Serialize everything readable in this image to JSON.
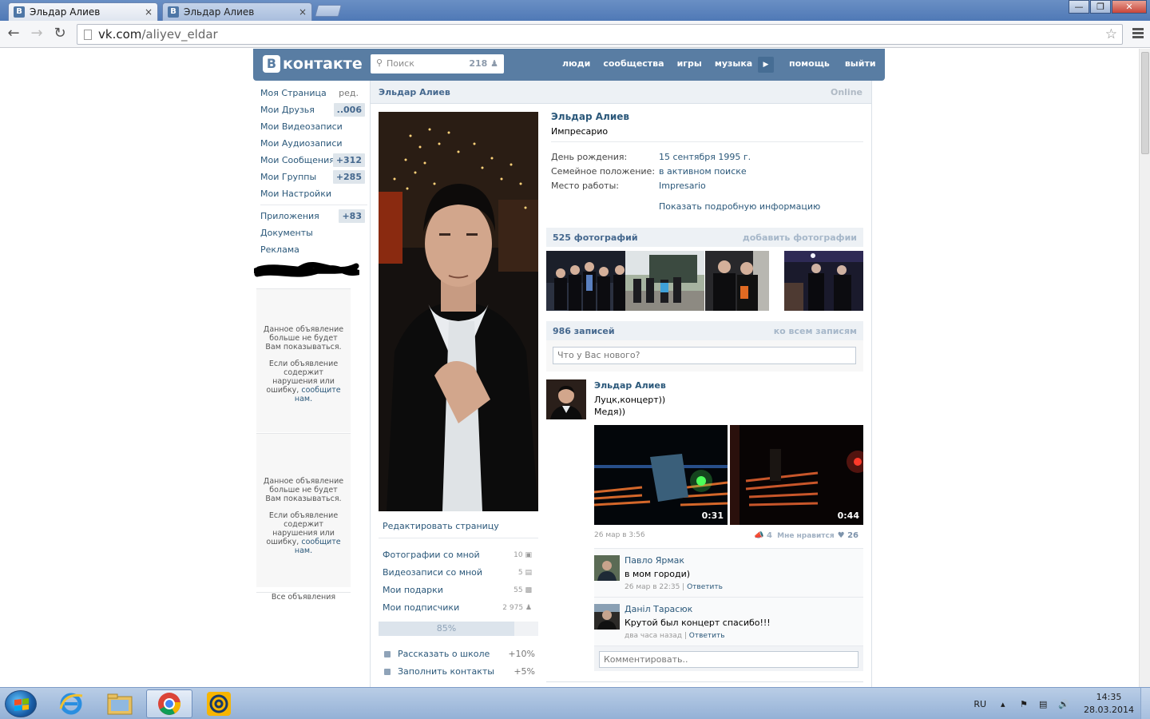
{
  "browser": {
    "tabs": [
      {
        "title": "Эльдар Алиев",
        "active": true
      },
      {
        "title": "Эльдар Алиев",
        "active": false
      }
    ],
    "tab_close": "×",
    "url_host": "vk.com",
    "url_path": "/aliyev_eldar",
    "window_buttons": {
      "minimize": "—",
      "maximize": "❐",
      "close": "✕"
    }
  },
  "vk": {
    "logo_letter": "В",
    "logo_text": "контакте",
    "search": {
      "placeholder": "Поиск",
      "count": "218"
    },
    "nav": [
      "люди",
      "сообщества",
      "игры",
      "музыка"
    ],
    "nav_right": [
      "помощь",
      "выйти"
    ]
  },
  "left_menu": {
    "items": [
      {
        "label": "Моя Страница",
        "extra": "ред."
      },
      {
        "label": "Мои Друзья",
        "badge": "..006"
      },
      {
        "label": "Мои Видеозаписи"
      },
      {
        "label": "Мои Аудиозаписи"
      },
      {
        "label": "Мои Сообщения",
        "badge": "+312"
      },
      {
        "label": "Мои Группы",
        "badge": "+285"
      },
      {
        "label": "Мои Настройки"
      }
    ],
    "items2": [
      {
        "label": "Приложения",
        "badge": "+83"
      },
      {
        "label": "Документы"
      },
      {
        "label": "Реклама"
      }
    ],
    "ad": {
      "text1": "Данное объявление больше не будет Вам показываться.",
      "text2": "Если объявление содержит нарушения или ошибку,",
      "link": "сообщите нам."
    },
    "all_ads": "Все объявления"
  },
  "profile": {
    "header_name": "Эльдар Алиев",
    "online": "Online",
    "name": "Эльдар Алиев",
    "status": "Импресарио",
    "info": [
      {
        "label": "День рождения:",
        "value": "15 сентября 1995 г."
      },
      {
        "label": "Семейное положение:",
        "value": "в активном поиске"
      },
      {
        "label": "Место работы:",
        "value": "Impresario"
      }
    ],
    "more": "Показать подробную информацию",
    "edit_page": "Редактировать страницу",
    "links": [
      {
        "label": "Фотографии со мной",
        "count": "10"
      },
      {
        "label": "Видеозаписи со мной",
        "count": "5"
      },
      {
        "label": "Мои подарки",
        "count": "55"
      },
      {
        "label": "Мои подписчики",
        "count": "2 975"
      }
    ],
    "completion": {
      "text": "85%",
      "value": 0.85
    },
    "tasks": [
      {
        "label": "Рассказать о школе",
        "pct": "+10%"
      },
      {
        "label": "Заполнить контакты",
        "pct": "+5%"
      }
    ]
  },
  "photos": {
    "title": "525 фотографий",
    "action": "добавить фотографии"
  },
  "wall": {
    "title": "986 записей",
    "action": "ко всем записям",
    "input_placeholder": "Что у Вас нового?",
    "post": {
      "author": "Эльдар Алиев",
      "line1": "Луцк,концерт))",
      "line2": "Медя))",
      "videos": [
        "0:31",
        "0:44"
      ],
      "date": "26 мар в 3:56",
      "shares": "4",
      "like_label": "Мне нравится",
      "likes": "26"
    },
    "comments": [
      {
        "name": "Павло Ярмак",
        "text": "в мом городи)",
        "date": "26 мар в 22:35",
        "reply": "Ответить"
      },
      {
        "name": "Даніл Тарасюк",
        "text": "Крутой был концерт спасибо!!!",
        "date": "два часа назад",
        "reply": "Ответить"
      }
    ],
    "comment_placeholder": "Комментировать.."
  },
  "taskbar": {
    "lang": "RU",
    "time": "14:35",
    "date": "28.03.2014"
  }
}
